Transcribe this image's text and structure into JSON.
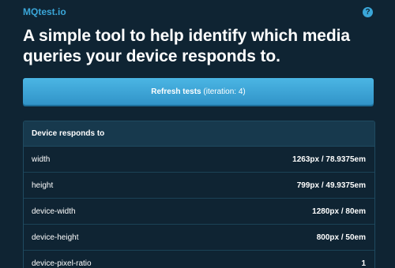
{
  "header": {
    "logo": "MQtest.io",
    "help_icon": "question-icon",
    "help_glyph": "?"
  },
  "headline": "A simple tool to help identify which media queries your device responds to.",
  "refresh": {
    "label": "Refresh tests",
    "iteration": "(iteration: 4)"
  },
  "table": {
    "title": "Device responds to",
    "rows": [
      {
        "key": "width",
        "value": "1263px / 78.9375em"
      },
      {
        "key": "height",
        "value": "799px / 49.9375em"
      },
      {
        "key": "device-width",
        "value": "1280px / 80em"
      },
      {
        "key": "device-height",
        "value": "800px / 50em"
      },
      {
        "key": "device-pixel-ratio",
        "value": "1"
      }
    ]
  },
  "colors": {
    "background": "#0f2433",
    "accent": "#3aa6d8",
    "button": "#3ea8d9",
    "table_header": "#17394d"
  }
}
